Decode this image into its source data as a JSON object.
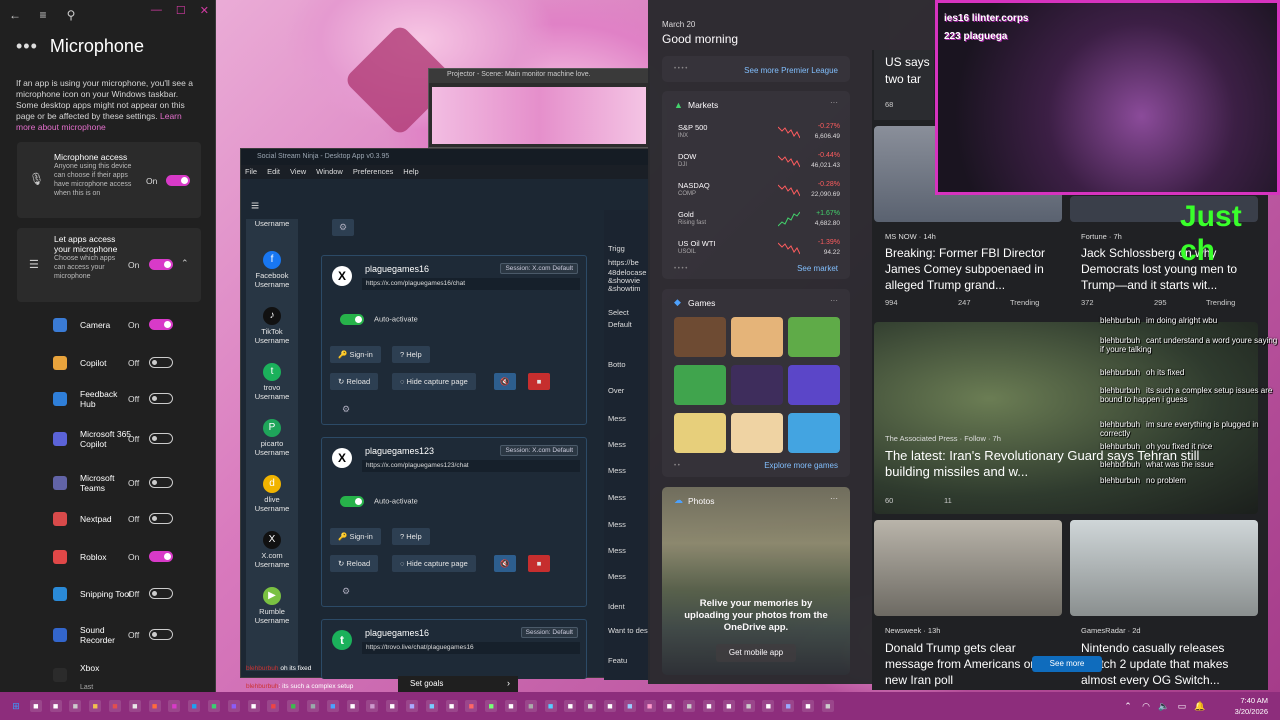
{
  "settings": {
    "title": "Microphone",
    "window_controls": [
      "—",
      "☐",
      "✕"
    ],
    "desc": "If an app is using your microphone, you'll see a microphone icon on your Windows taskbar. Some desktop apps might not appear on this page or be affected by these settings.",
    "learn_more": "Learn more about microphone",
    "access": {
      "title": "Microphone access",
      "sub": "Anyone using this device can choose if their apps have microphone access when this is on",
      "state": "On"
    },
    "let_apps": {
      "title": "Let apps access your microphone",
      "sub": "Choose which apps can access your microphone",
      "state": "On"
    },
    "apps": [
      {
        "name": "Camera",
        "state": "On",
        "color": "#3a7bd5"
      },
      {
        "name": "Copilot",
        "state": "Off",
        "color": "#e8a33c"
      },
      {
        "name": "Feedback Hub",
        "state": "Off",
        "color": "#2f7fd9"
      },
      {
        "name": "Microsoft 365 Copilot",
        "state": "Off",
        "color": "#5b63d8"
      },
      {
        "name": "Microsoft Teams",
        "state": "Off",
        "color": "#6264a7"
      },
      {
        "name": "Nextpad",
        "state": "Off",
        "color": "#d84a4a"
      },
      {
        "name": "Roblox",
        "state": "On",
        "color": "#e04848"
      },
      {
        "name": "Snipping Tool",
        "state": "Off",
        "color": "#2a8ad8"
      },
      {
        "name": "Sound Recorder",
        "state": "Off",
        "color": "#3366cc"
      },
      {
        "name": "Xbox",
        "state": "",
        "color": "#2b2b2b"
      }
    ],
    "xbox_sub": "Last"
  },
  "projector": {
    "title": "Projector - Scene: Main monitor machine love."
  },
  "ssn": {
    "title": "Social Stream Ninja - Desktop App v0.3.95",
    "menu": [
      "File",
      "Edit",
      "View",
      "Window",
      "Preferences",
      "Help"
    ],
    "side": [
      {
        "label": "Username",
        "icon": "",
        "color": "#283644"
      },
      {
        "label": "Facebook Username",
        "icon": "f",
        "color": "#1877f2"
      },
      {
        "label": "TikTok Username",
        "icon": "♪",
        "color": "#111"
      },
      {
        "label": "trovo Username",
        "icon": "t",
        "color": "#1bb15b"
      },
      {
        "label": "picarto Username",
        "icon": "P",
        "color": "#1fa55a"
      },
      {
        "label": "dlive Username",
        "icon": "d",
        "color": "#f1b400"
      },
      {
        "label": "X.com Username",
        "icon": "X",
        "color": "#111"
      },
      {
        "label": "Rumble Username",
        "icon": "▶",
        "color": "#7ac142"
      }
    ],
    "accounts": [
      {
        "name": "plaguegames16",
        "badge": "Session: X.com Default",
        "url": "https://x.com/plaguegames16/chat",
        "auto": "Auto-activate",
        "signin": "Sign-in",
        "help": "Help",
        "reload": "Reload",
        "hide": "Hide capture page"
      },
      {
        "name": "plaguegames123",
        "badge": "Session: X.com Default",
        "url": "https://x.com/plaguegames123/chat",
        "auto": "Auto-activate",
        "signin": "Sign-in",
        "help": "Help",
        "reload": "Reload",
        "hide": "Hide capture page"
      },
      {
        "name": "plaguegames16",
        "badge": "Session: Default",
        "url": "https://trovo.live/chat/plaguegames16"
      }
    ],
    "chat_lines": [
      "oh its fixed",
      ": its such a complex setup"
    ]
  },
  "midstrip": [
    "Trigg",
    "https://be",
    "48delocase",
    "&showvie",
    "&showtim",
    "Select",
    "Default",
    "Botto",
    "Over",
    "Mess",
    "Mess",
    "Mess",
    "Mess",
    "Mess",
    "Mess",
    "Mess",
    "Ident",
    "Want to des",
    "Featu"
  ],
  "goals": {
    "label": "Set goals"
  },
  "widgets": {
    "date": "March 20",
    "greeting": "Good morning",
    "premier_link": "See more Premier League",
    "markets": {
      "title": "Markets",
      "rows": [
        {
          "sym": "S&P 500",
          "sub": "INX",
          "chg": "-0.27%",
          "px": "6,606.49",
          "color": "#ff5c5c"
        },
        {
          "sym": "DOW",
          "sub": "DJI",
          "chg": "-0.44%",
          "px": "46,021.43",
          "color": "#ff5c5c"
        },
        {
          "sym": "NASDAQ",
          "sub": "COMP",
          "chg": "-0.28%",
          "px": "22,090.69",
          "color": "#ff5c5c"
        },
        {
          "sym": "Gold",
          "sub": "Rising fast",
          "chg": "+1.67%",
          "px": "4,682.80",
          "color": "#3fd66a"
        },
        {
          "sym": "US Oil WTI",
          "sub": "USOIL",
          "chg": "-1.39%",
          "px": "94.22",
          "color": "#ff5c5c"
        }
      ],
      "link": "See market"
    },
    "games": {
      "title": "Games",
      "link": "Explore more games"
    },
    "photos": {
      "title": "Photos",
      "text": "Relive your memories by uploading your photos from the OneDrive app.",
      "button": "Get mobile app"
    }
  },
  "news": {
    "top_partial": "US says two tar",
    "top_partial_count": "68",
    "items": [
      {
        "src": "MS NOW · 14h",
        "headline": "Breaking: Former FBI Director James Comey subpoenaed in alleged Trump grand...",
        "likes": "994",
        "comments": "247",
        "tag": "Trending"
      },
      {
        "src": "Fortune · 7h",
        "headline": "Jack Schlossberg on why Democrats lost young men to Trump—and it starts wit...",
        "likes": "372",
        "comments": "295",
        "tag": "Trending"
      },
      {
        "src": "The Associated Press · Follow · 7h",
        "headline": "The latest: Iran's Revolutionary Guard says Tehran still building missiles and w...",
        "likes": "60",
        "comments": "11"
      },
      {
        "src": "Newsweek · 13h",
        "headline": "Donald Trump gets clear message from Americans on new Iran poll"
      },
      {
        "src": "GamesRadar · 2d",
        "headline": "Nintendo casually releases Switch 2 update that makes almost every OG Switch..."
      }
    ],
    "see_more": "See more"
  },
  "cam": {
    "line1": "ies16 lilnter.corps",
    "line2": "223 plaguega",
    "overlay": "Just ch"
  },
  "chat_overlay": [
    {
      "user": "blehburbuh",
      "msg": "im doing alright wbu"
    },
    {
      "user": "blehburbuh",
      "msg": "cant understand a word youre saying if youre talking"
    },
    {
      "user": "blehburbuh",
      "msg": "oh its fixed"
    },
    {
      "user": "blehburbuh",
      "msg": "its such a complex setup issues are bound to happen i guess"
    },
    {
      "user": "blehburbuh",
      "msg": "im sure everything is plugged in correctly"
    },
    {
      "user": "blehburbuh",
      "msg": "oh you fixed it nice"
    },
    {
      "user": "blehburbuh",
      "msg": "what was the issue"
    },
    {
      "user": "blehburbuh",
      "msg": "no problem"
    }
  ],
  "clock": {
    "time": "7:40 AM",
    "date": "3/20/2026"
  },
  "colors": {
    "accent": "#d83ac8",
    "taskbar": "#8d2d7c"
  }
}
